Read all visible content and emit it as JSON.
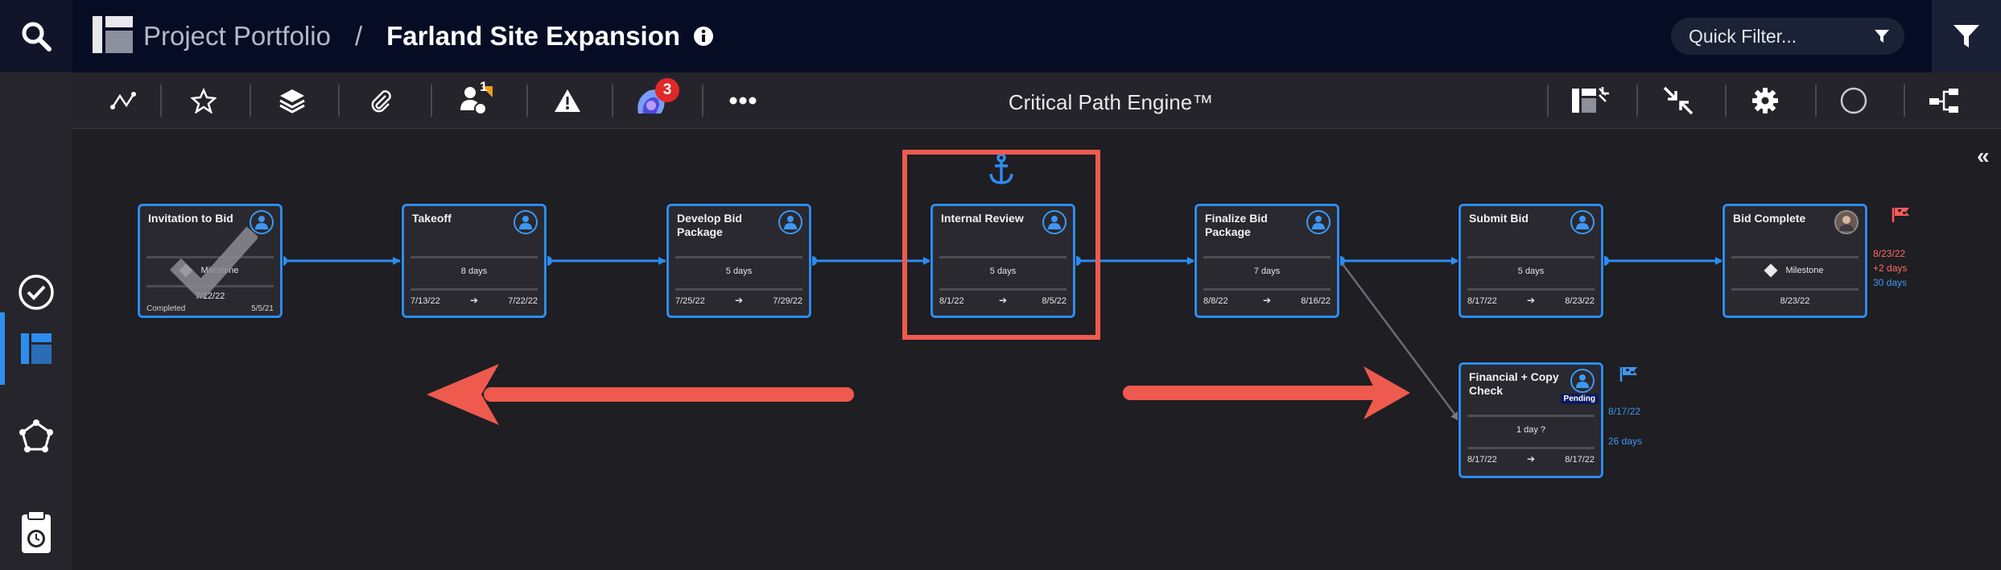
{
  "header": {
    "breadcrumb_root": "Project Portfolio",
    "breadcrumb_separator": "/",
    "page_title": "Farland Site Expansion",
    "quick_filter_placeholder": "Quick Filter...",
    "icons": [
      "search-icon",
      "project-portfolio-icon",
      "info-icon",
      "funnel-icon",
      "filter-icon"
    ]
  },
  "sidebar": {
    "items": [
      {
        "name": "tasks-icon"
      },
      {
        "name": "portfolio-icon",
        "active": true
      },
      {
        "name": "network-icon"
      },
      {
        "name": "timesheet-icon"
      }
    ]
  },
  "toolbar": {
    "title": "Critical Path Engine™",
    "resource_badge": "1",
    "collaborators_badge": "3",
    "left_icons": [
      "path-icon",
      "star-icon",
      "layers-icon",
      "paperclip-icon",
      "resources-icon",
      "warning-icon",
      "collaborators-icon",
      "more-icon"
    ],
    "right_icons": [
      "collapse-panel-icon",
      "compress-icon",
      "gear-icon",
      "circle-icon",
      "network-layout-icon"
    ]
  },
  "tasks": [
    {
      "title": "Invitation to Bid",
      "type": "milestone",
      "milestone_label": "Milestone",
      "date": "7/12/22",
      "status": "Completed",
      "completed_date": "5/5/21"
    },
    {
      "title": "Takeoff",
      "duration": "8 days",
      "start": "7/13/22",
      "end": "7/22/22"
    },
    {
      "title": "Develop Bid Package",
      "duration": "5 days",
      "start": "7/25/22",
      "end": "7/29/22"
    },
    {
      "title": "Internal Review",
      "duration": "5 days",
      "start": "8/1/22",
      "end": "8/5/22"
    },
    {
      "title": "Finalize Bid Package",
      "duration": "7 days",
      "start": "8/8/22",
      "end": "8/16/22"
    },
    {
      "title": "Submit Bid",
      "duration": "5 days",
      "start": "8/17/22",
      "end": "8/23/22"
    },
    {
      "title": "Bid Complete",
      "type": "milestone",
      "milestone_label": "Milestone",
      "date": "8/23/22",
      "note_date": "8/23/22",
      "note_delta": "+2 days",
      "note_float": "30 days"
    },
    {
      "title": "Financial + Copy Check",
      "duration": "1 day ?",
      "start": "8/17/22",
      "end": "8/17/22",
      "badge": "Pending",
      "note_date": "8/17/22",
      "note_float": "26 days"
    }
  ],
  "arrow_glyph": "➔",
  "colors": {
    "accent": "#2d8cf0",
    "highlight": "#ee5a4e",
    "late": "#ff6b6b",
    "float": "#3d97f3"
  }
}
